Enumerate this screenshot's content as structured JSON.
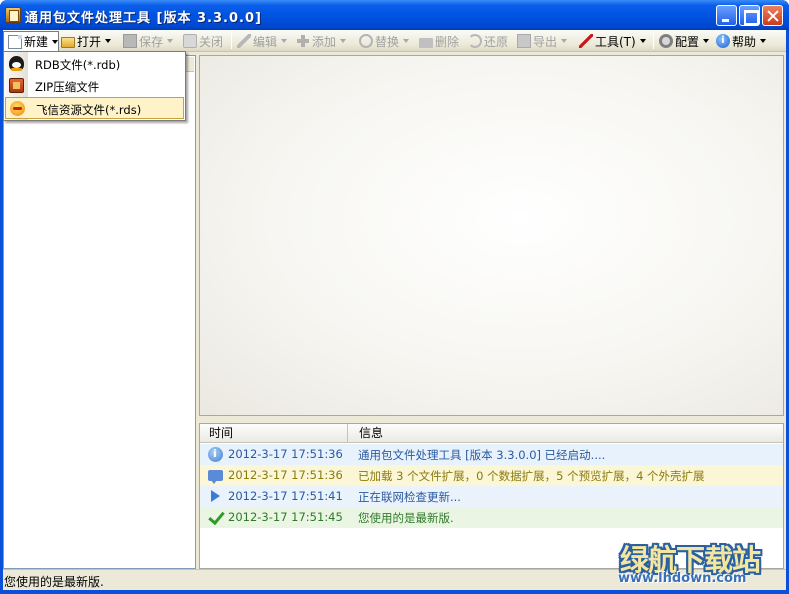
{
  "window": {
    "title": "通用包文件处理工具 [版本 3.3.0.0]"
  },
  "toolbar": {
    "items": [
      {
        "id": "new",
        "label": "新建",
        "icon": "new-file-icon",
        "enabled": true,
        "pressed": true
      },
      {
        "id": "open",
        "label": "打开",
        "icon": "folder-open-icon",
        "enabled": true
      },
      {
        "id": "save",
        "label": "保存",
        "icon": "save-icon",
        "enabled": false
      },
      {
        "id": "close",
        "label": "关闭",
        "icon": "close-file-icon",
        "enabled": false
      },
      {
        "id": "edit",
        "label": "编辑",
        "icon": "pencil-icon",
        "enabled": false
      },
      {
        "id": "add",
        "label": "添加",
        "icon": "plus-icon",
        "enabled": false
      },
      {
        "id": "replace",
        "label": "替换",
        "icon": "replace-icon",
        "enabled": false
      },
      {
        "id": "delete",
        "label": "删除",
        "icon": "delete-icon",
        "enabled": false
      },
      {
        "id": "restore",
        "label": "还原",
        "icon": "restore-icon",
        "enabled": false
      },
      {
        "id": "export",
        "label": "导出",
        "icon": "export-icon",
        "enabled": false
      },
      {
        "id": "tools",
        "label": "工具(T)",
        "icon": "tools-icon",
        "enabled": true
      },
      {
        "id": "config",
        "label": "配置",
        "icon": "gear-icon",
        "enabled": true
      },
      {
        "id": "help",
        "label": "帮助",
        "icon": "help-icon",
        "enabled": true
      }
    ]
  },
  "new_menu": {
    "items": [
      {
        "label": "RDB文件(*.rdb)",
        "icon": "qq-penguin-icon"
      },
      {
        "label": "ZIP压缩文件",
        "icon": "zip-archive-icon"
      },
      {
        "label": "飞信资源文件(*.rds)",
        "icon": "fetion-icon",
        "selected": true
      }
    ]
  },
  "log": {
    "columns": {
      "time": "时间",
      "message": "信息"
    },
    "rows": [
      {
        "type": "info",
        "icon": "info-icon",
        "time": "2012-3-17 17:51:36",
        "message": "通用包文件处理工具 [版本 3.3.0.0] 已经启动...."
      },
      {
        "type": "warn",
        "icon": "message-icon",
        "time": "2012-3-17 17:51:36",
        "message": "已加载 3 个文件扩展，0 个数据扩展，5 个预览扩展，4 个外壳扩展"
      },
      {
        "type": "play",
        "icon": "play-icon",
        "time": "2012-3-17 17:51:41",
        "message": "正在联网检查更新..."
      },
      {
        "type": "ok",
        "icon": "checkmark-icon",
        "time": "2012-3-17 17:51:45",
        "message": "您使用的是最新版."
      }
    ]
  },
  "status": {
    "text": "您使用的是最新版."
  },
  "watermark": {
    "logo_text": "绿航下载站",
    "url": "www.lhdown.com"
  },
  "colors": {
    "titlebar": "#0054e3",
    "chrome": "#ece9d8",
    "menu_highlight": "#fef3c8",
    "info_text": "#2a5aa0",
    "warn_text": "#8a7a10",
    "ok_text": "#2f7a2a"
  }
}
